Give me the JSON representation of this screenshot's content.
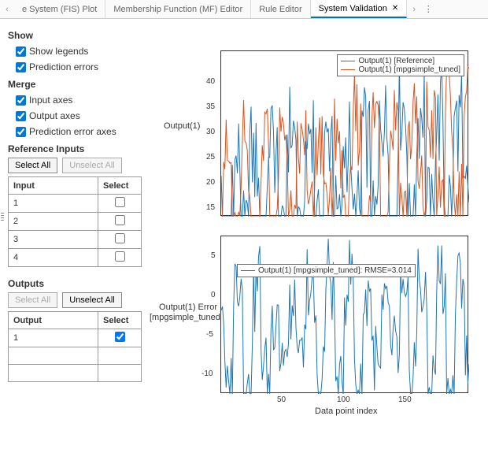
{
  "tabs": {
    "prev_visible": "e System (FIS) Plot",
    "items": [
      "Membership Function (MF) Editor",
      "Rule Editor",
      "System Validation"
    ],
    "active_index": 2
  },
  "side": {
    "show": {
      "title": "Show",
      "legends": "Show legends",
      "errors": "Prediction errors"
    },
    "merge": {
      "title": "Merge",
      "input": "Input axes",
      "output": "Output axes",
      "error": "Prediction error axes"
    },
    "refinputs": {
      "title": "Reference Inputs",
      "select_all": "Select All",
      "unselect_all": "Unselect All",
      "col_input": "Input",
      "col_select": "Select",
      "rows": [
        "1",
        "2",
        "3",
        "4"
      ]
    },
    "outputs": {
      "title": "Outputs",
      "select_all": "Select All",
      "unselect_all": "Unselect All",
      "col_output": "Output",
      "col_select": "Select",
      "rows": [
        "1"
      ]
    }
  },
  "plots": {
    "top": {
      "ylabel": "Output(1)",
      "legend": [
        "Output(1) [Reference]",
        "Output(1) [mpgsimple_tuned]"
      ],
      "color1": "#1f77b4",
      "color2": "#d9541e"
    },
    "bottom": {
      "ylabel1": "Output(1) Error",
      "ylabel2": "[mpgsimple_tuned]",
      "legend": "Output(1) [mpgsimple_tuned]: RMSE=3.014",
      "color1": "#1f77b4",
      "xlabel": "Data point index"
    }
  },
  "chart_data": [
    {
      "type": "line",
      "title": "",
      "xlabel": "Data point index",
      "ylabel": "Output(1)",
      "xlim": [
        0,
        200
      ],
      "ylim": [
        12,
        45
      ],
      "yticks": [
        15,
        20,
        25,
        30,
        35,
        40
      ],
      "series": [
        {
          "name": "Output(1) [Reference]",
          "color": "#1f77b4"
        },
        {
          "name": "Output(1) [mpgsimple_tuned]",
          "color": "#d9541e"
        }
      ],
      "note": "Dense noisy oscillation ~13–44 across 200 points; both series track closely."
    },
    {
      "type": "line",
      "title": "",
      "xlabel": "Data point index",
      "ylabel": "Output(1) Error [mpgsimple_tuned]",
      "xlim": [
        0,
        200
      ],
      "ylim": [
        -13,
        7
      ],
      "yticks": [
        -10,
        -5,
        0,
        5
      ],
      "xticks": [
        50,
        100,
        150
      ],
      "series": [
        {
          "name": "Output(1) [mpgsimple_tuned]: RMSE=3.014",
          "color": "#1f77b4"
        }
      ],
      "note": "Error fluctuates around zero, mostly within ±5."
    }
  ]
}
